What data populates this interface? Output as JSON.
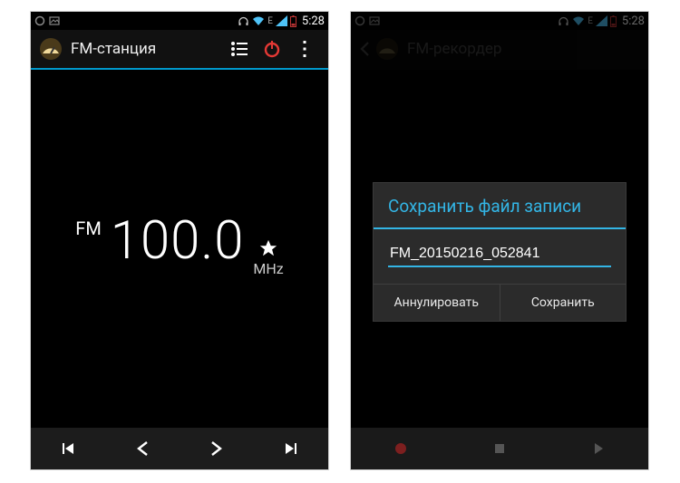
{
  "status": {
    "time": "5:28",
    "network_label": "E"
  },
  "left": {
    "title": "FM-станция",
    "band": "FM",
    "frequency": "100.0",
    "unit": "MHz"
  },
  "right": {
    "title": "FM-рекордер",
    "dialog": {
      "title": "Сохранить файл записи",
      "filename": "FM_20150216_052841",
      "cancel": "Аннулировать",
      "save": "Сохранить"
    }
  }
}
